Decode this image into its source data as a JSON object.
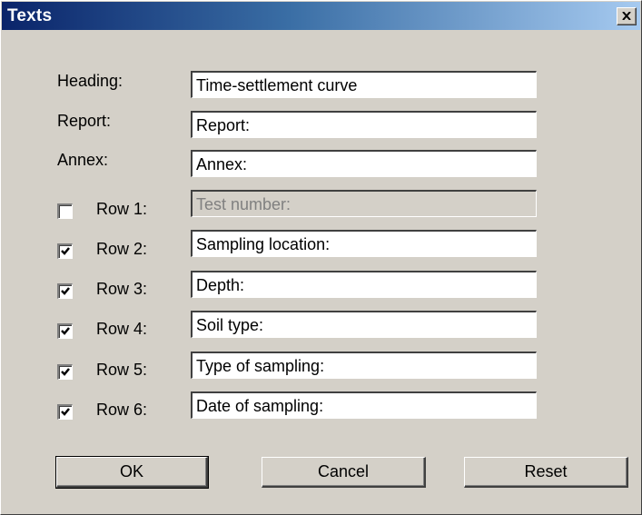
{
  "window": {
    "title": "Texts"
  },
  "fields": {
    "heading": {
      "label": "Heading:",
      "value": "Time-settlement curve"
    },
    "report": {
      "label": "Report:",
      "value": "Report:"
    },
    "annex": {
      "label": "Annex:",
      "value": "Annex:"
    }
  },
  "rows": [
    {
      "label": "Row 1:",
      "checked": false,
      "value": "Test number:",
      "enabled": false
    },
    {
      "label": "Row 2:",
      "checked": true,
      "value": "Sampling location:",
      "enabled": true
    },
    {
      "label": "Row 3:",
      "checked": true,
      "value": "Depth:",
      "enabled": true
    },
    {
      "label": "Row 4:",
      "checked": true,
      "value": "Soil type:",
      "enabled": true
    },
    {
      "label": "Row 5:",
      "checked": true,
      "value": "Type of sampling:",
      "enabled": true
    },
    {
      "label": "Row 6:",
      "checked": true,
      "value": "Date of sampling:",
      "enabled": true
    }
  ],
  "buttons": {
    "ok": "OK",
    "cancel": "Cancel",
    "reset": "Reset"
  }
}
